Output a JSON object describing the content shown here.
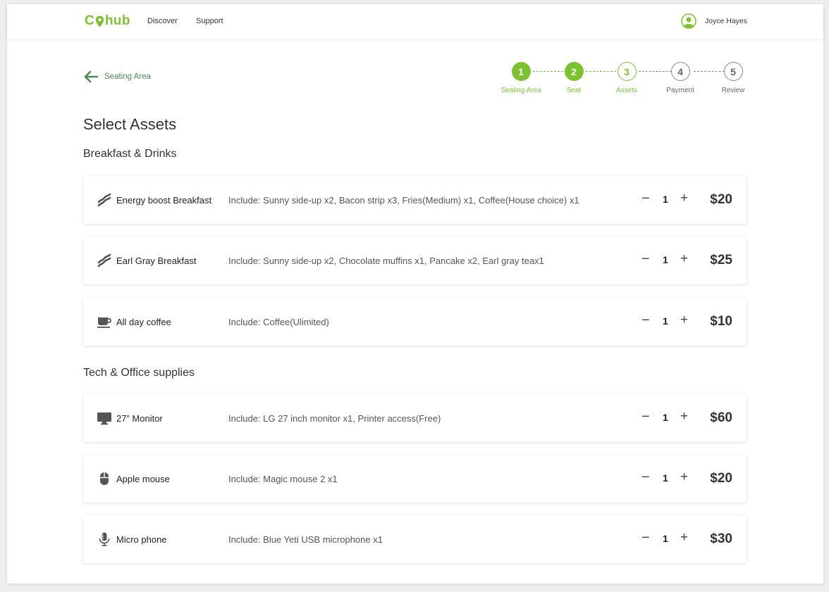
{
  "header": {
    "logo_left": "C",
    "logo_right": "hub",
    "nav": [
      "Discover",
      "Support"
    ],
    "user_name": "Joyce Hayes"
  },
  "back_link": "Seating Area",
  "stepper": [
    {
      "number": "1",
      "label": "Seating Area",
      "state": "done"
    },
    {
      "number": "2",
      "label": "Seat",
      "state": "done"
    },
    {
      "number": "3",
      "label": "Assets",
      "state": "current"
    },
    {
      "number": "4",
      "label": "Payment",
      "state": "todo"
    },
    {
      "number": "5",
      "label": "Review",
      "state": "todo"
    }
  ],
  "page_title": "Select Assets",
  "sections": [
    {
      "title": "Breakfast & Drinks",
      "items": [
        {
          "icon": "breakfast-icon",
          "name": "Energy boost Breakfast",
          "desc": "Include: Sunny side-up x2, Bacon strip x3, Fries(Medium) x1, Coffee(House choice) x1",
          "qty": "1",
          "price": "$20"
        },
        {
          "icon": "breakfast-icon",
          "name": "Earl Gray Breakfast",
          "desc": "Include: Sunny side-up x2, Chocolate muffins x1, Pancake x2, Earl gray teax1",
          "qty": "1",
          "price": "$25"
        },
        {
          "icon": "coffee-cup-icon",
          "name": "All day coffee",
          "desc": "Include: Coffee(Ulimited)",
          "qty": "1",
          "price": "$10"
        }
      ]
    },
    {
      "title": "Tech & Office supplies",
      "items": [
        {
          "icon": "monitor-icon",
          "name": "27” Monitor",
          "desc": "Include: LG 27 inch monitor x1, Printer access(Free)",
          "qty": "1",
          "price": "$60"
        },
        {
          "icon": "mouse-icon",
          "name": "Apple mouse",
          "desc": "Include: Magic mouse 2 x1",
          "qty": "1",
          "price": "$20"
        },
        {
          "icon": "microphone-icon",
          "name": "Micro phone",
          "desc": "Include: Blue Yeti USB microphone x1",
          "qty": "1",
          "price": "$30"
        }
      ]
    }
  ],
  "controls": {
    "minus": "−",
    "plus": "+"
  },
  "colors": {
    "accent": "#7cc230",
    "back_link": "#4a8a52",
    "text": "#333333"
  }
}
